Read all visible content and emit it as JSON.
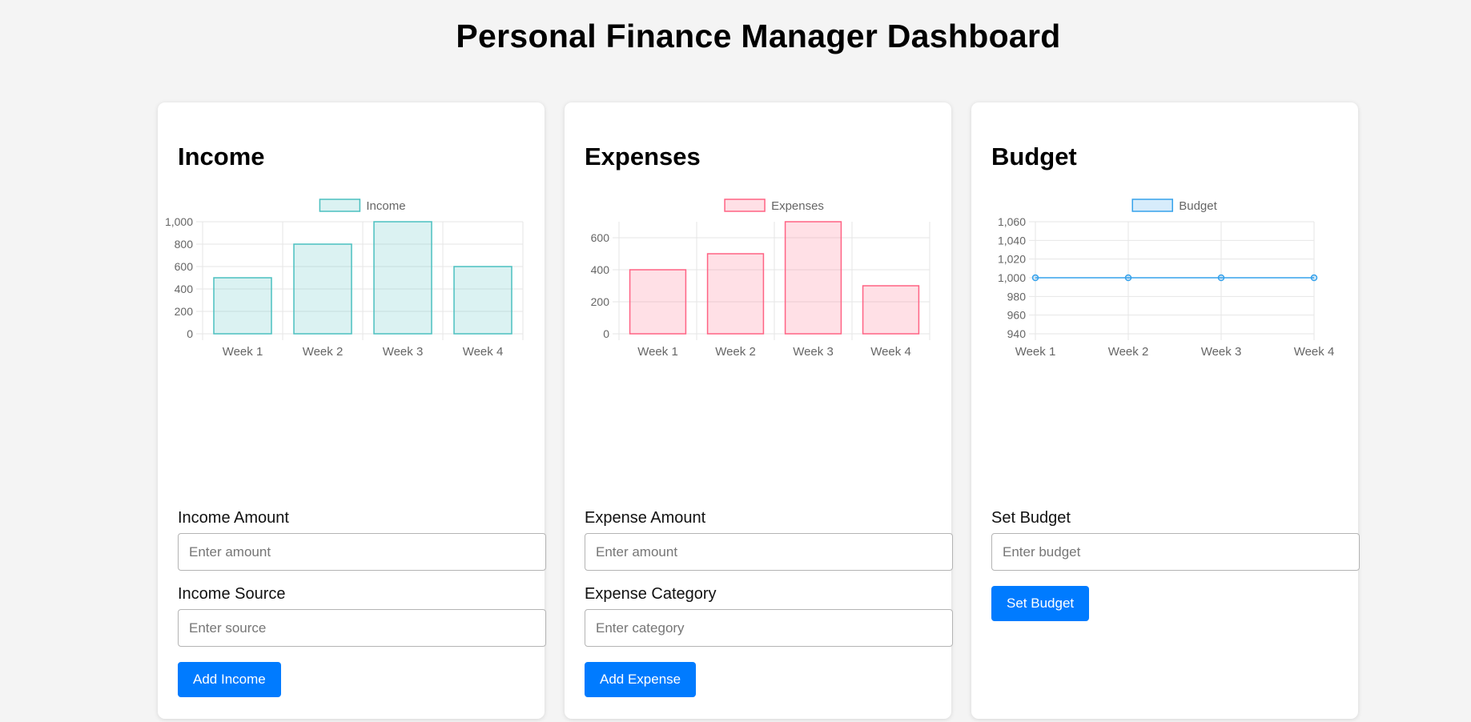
{
  "page": {
    "title": "Personal Finance Manager Dashboard"
  },
  "colors": {
    "accent": "#007bff",
    "grid": "#e6e6e6",
    "tick_text": "#666666"
  },
  "income": {
    "title": "Income",
    "amount_label": "Income Amount",
    "amount_placeholder": "Enter amount",
    "source_label": "Income Source",
    "source_placeholder": "Enter source",
    "button_label": "Add Income"
  },
  "expenses": {
    "title": "Expenses",
    "amount_label": "Expense Amount",
    "amount_placeholder": "Enter amount",
    "category_label": "Expense Category",
    "category_placeholder": "Enter category",
    "button_label": "Add Expense"
  },
  "budget": {
    "title": "Budget",
    "set_label": "Set Budget",
    "set_placeholder": "Enter budget",
    "button_label": "Set Budget"
  },
  "chart_data": [
    {
      "id": "income",
      "type": "bar",
      "categories": [
        "Week 1",
        "Week 2",
        "Week 3",
        "Week 4"
      ],
      "series": [
        {
          "name": "Income",
          "values": [
            500,
            800,
            1000,
            600
          ],
          "fill": "rgba(75,192,192,0.2)",
          "stroke": "#4bc0c0"
        }
      ],
      "ylim": [
        0,
        1000
      ],
      "yticks": [
        0,
        200,
        400,
        600,
        800,
        1000
      ],
      "ytick_labels": [
        "0",
        "200",
        "400",
        "600",
        "800",
        "1,000"
      ],
      "grid": true,
      "legend": "top-center"
    },
    {
      "id": "expenses",
      "type": "bar",
      "categories": [
        "Week 1",
        "Week 2",
        "Week 3",
        "Week 4"
      ],
      "series": [
        {
          "name": "Expenses",
          "values": [
            400,
            500,
            700,
            300
          ],
          "fill": "rgba(255,99,132,0.2)",
          "stroke": "#ff6384"
        }
      ],
      "ylim": [
        0,
        700
      ],
      "yticks": [
        0,
        200,
        400,
        600
      ],
      "ytick_labels": [
        "0",
        "200",
        "400",
        "600"
      ],
      "grid": true,
      "legend": "top-center"
    },
    {
      "id": "budget",
      "type": "line",
      "categories": [
        "Week 1",
        "Week 2",
        "Week 3",
        "Week 4"
      ],
      "series": [
        {
          "name": "Budget",
          "values": [
            1000,
            1000,
            1000,
            1000
          ],
          "fill": "rgba(54,162,235,0.2)",
          "stroke": "#36a2eb"
        }
      ],
      "ylim": [
        940,
        1060
      ],
      "yticks": [
        940,
        960,
        980,
        1000,
        1020,
        1040,
        1060
      ],
      "ytick_labels": [
        "940",
        "960",
        "980",
        "1,000",
        "1,020",
        "1,040",
        "1,060"
      ],
      "grid": true,
      "legend": "top-center"
    }
  ]
}
